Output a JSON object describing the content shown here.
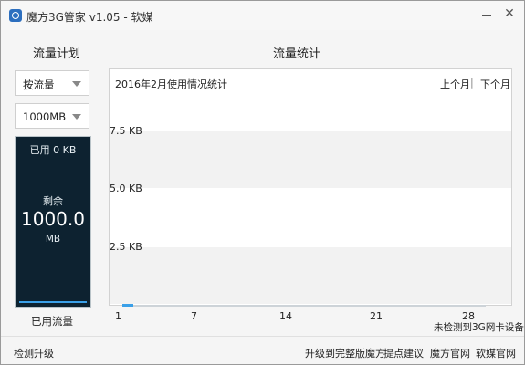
{
  "window": {
    "title": "魔方3G管家 v1.05 - 软媒",
    "close_glyph": "✕"
  },
  "plan": {
    "title": "流量计划",
    "mode_select": "按流量",
    "amount_select": "1000MB",
    "meter": {
      "used_text": "已用 0 KB",
      "remain_label": "剩余",
      "remain_value": "1000.0",
      "unit": "MB",
      "bar_color": "#3aa0e8"
    },
    "used_label": "已用流量"
  },
  "stats": {
    "title": "流量统计",
    "chart_title": "2016年2月使用情况统计",
    "prev_month": "上个月",
    "separator": "|",
    "next_month": "下个月",
    "status": "未检测到3G网卡设备"
  },
  "chart_data": {
    "type": "bar",
    "title": "2016年2月使用情况统计",
    "y_ticks": [
      "7.5 KB",
      "5.0 KB",
      "2.5 KB"
    ],
    "x_ticks": [
      "1",
      "7",
      "14",
      "21",
      "28"
    ],
    "values": []
  },
  "footer": {
    "check_update": "检测升级",
    "upgrade_full": "升级到完整版魔方",
    "feedback": "提点建议",
    "official_site": "魔方官网",
    "ruanmei_site": "软媒官网"
  }
}
